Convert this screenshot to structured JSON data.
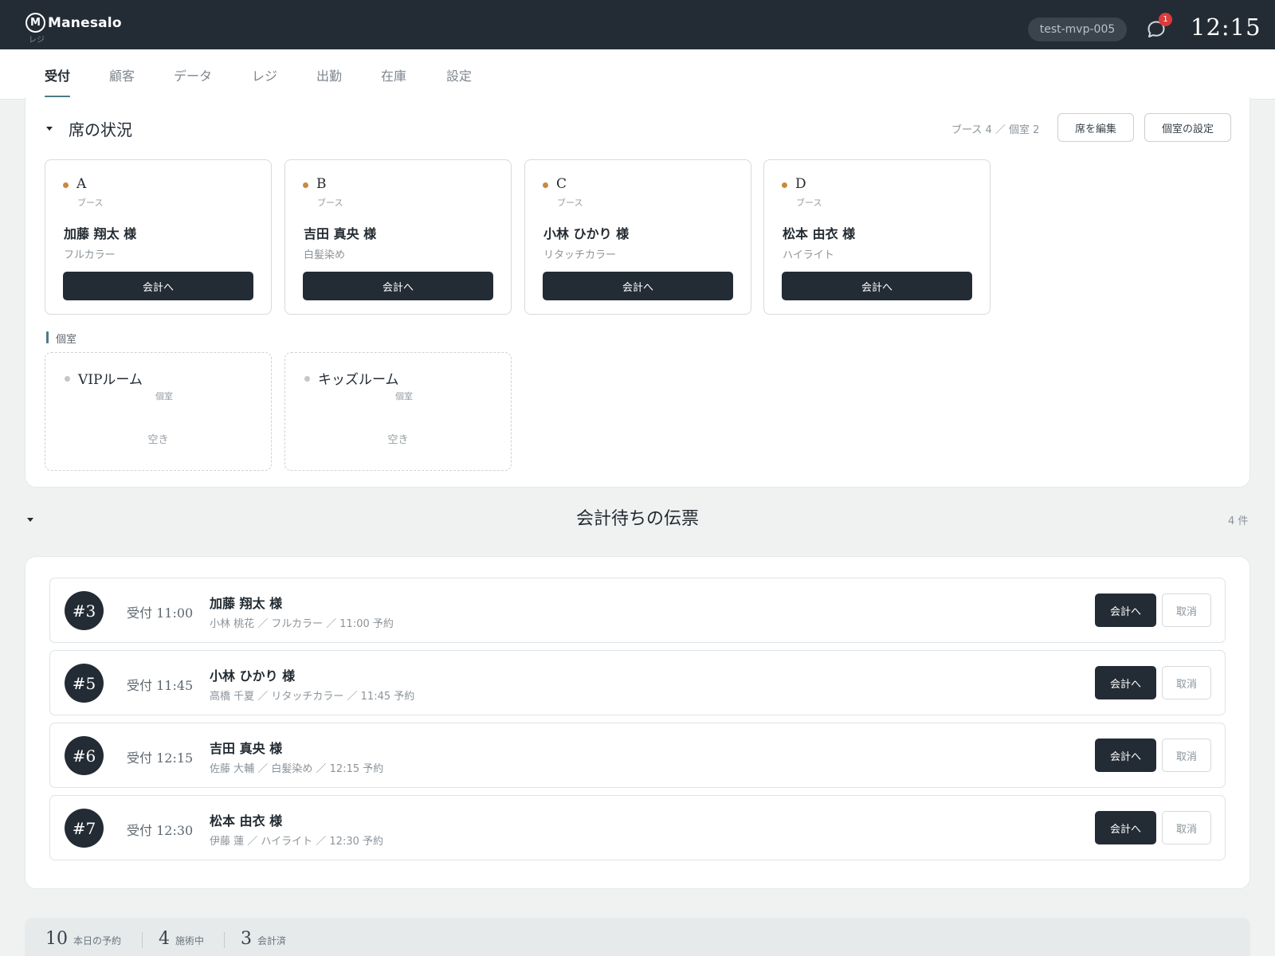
{
  "header": {
    "logo_mark": "M",
    "app_name": "Manesalo",
    "app_sub": "レジ",
    "store_id": "test-mvp-005",
    "notification_count": "1",
    "clock": "12:15"
  },
  "tabs": [
    {
      "label": "受付",
      "active": true
    },
    {
      "label": "顧客",
      "active": false
    },
    {
      "label": "データ",
      "active": false
    },
    {
      "label": "レジ",
      "active": false
    },
    {
      "label": "出勤",
      "active": false
    },
    {
      "label": "在庫",
      "active": false
    },
    {
      "label": "設定",
      "active": false
    }
  ],
  "seats": {
    "title": "席の状況",
    "summary": "ブース 4 ／ 個室 2",
    "edit_button": "席を編集",
    "room_settings_button": "個室の設定",
    "booths": [
      {
        "name": "A",
        "type": "ブース",
        "customer": "加藤 翔太 様",
        "service": "フルカラー",
        "action": "会計へ",
        "status": "busy"
      },
      {
        "name": "B",
        "type": "ブース",
        "customer": "吉田 真央 様",
        "service": "白髪染め",
        "action": "会計へ",
        "status": "busy"
      },
      {
        "name": "C",
        "type": "ブース",
        "customer": "小林 ひかり 様",
        "service": "リタッチカラー",
        "action": "会計へ",
        "status": "busy"
      },
      {
        "name": "D",
        "type": "ブース",
        "customer": "松本 由衣 様",
        "service": "ハイライト",
        "action": "会計へ",
        "status": "busy"
      }
    ],
    "rooms_label": "個室",
    "rooms": [
      {
        "name": "VIPルーム",
        "type": "個室",
        "status_text": "空き",
        "status": "free"
      },
      {
        "name": "キッズルーム",
        "type": "個室",
        "status_text": "空き",
        "status": "free"
      }
    ]
  },
  "waiting": {
    "title": "会計待ちの伝票",
    "count": "4 件",
    "slips": [
      {
        "number": "#3",
        "time": "受付 11:00",
        "customer": "加藤 翔太 様",
        "detail": "小林 桃花 ／ フルカラー ／ 11:00 予約",
        "pay_label": "会計へ",
        "cancel_label": "取消"
      },
      {
        "number": "#5",
        "time": "受付 11:45",
        "customer": "小林 ひかり 様",
        "detail": "高橋 千夏 ／ リタッチカラー ／ 11:45 予約",
        "pay_label": "会計へ",
        "cancel_label": "取消"
      },
      {
        "number": "#6",
        "time": "受付 12:15",
        "customer": "吉田 真央 様",
        "detail": "佐藤 大輔 ／ 白髪染め ／ 12:15 予約",
        "pay_label": "会計へ",
        "cancel_label": "取消"
      },
      {
        "number": "#7",
        "time": "受付 12:30",
        "customer": "松本 由衣 様",
        "detail": "伊藤 蓮 ／ ハイライト ／ 12:30 予約",
        "pay_label": "会計へ",
        "cancel_label": "取消"
      }
    ]
  },
  "stats": [
    {
      "value": "10",
      "label": "本日の予約"
    },
    {
      "value": "4",
      "label": "施術中"
    },
    {
      "value": "3",
      "label": "会計済"
    }
  ],
  "colors": {
    "header_bg": "#232c35",
    "accent": "#4e7a86",
    "busy_dot": "#c98a3a",
    "free_dot": "#c2c7cb",
    "badge": "#dc3b3b"
  }
}
